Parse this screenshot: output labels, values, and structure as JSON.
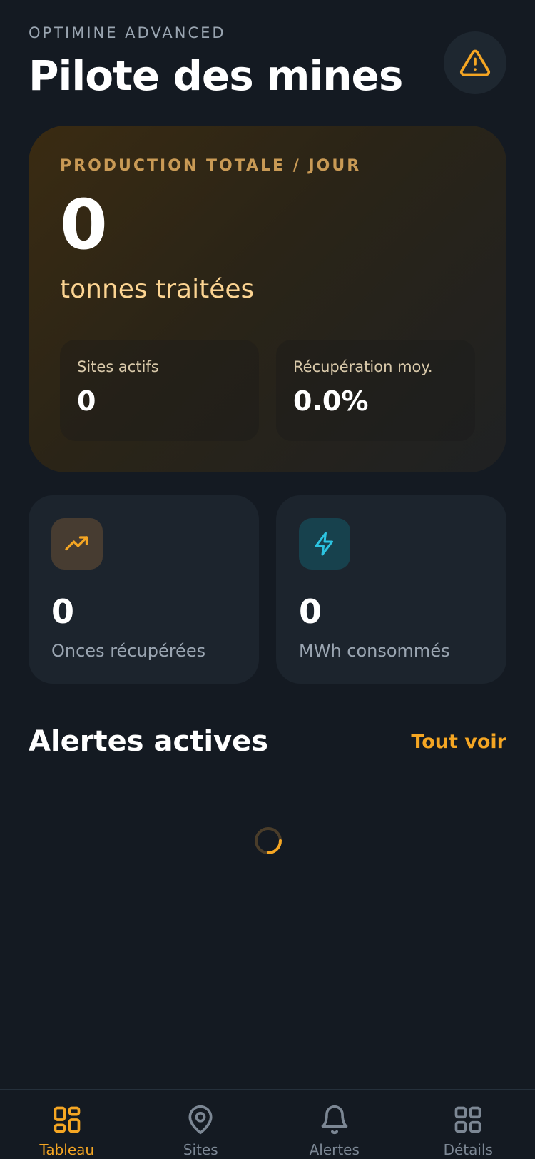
{
  "header": {
    "eyebrow": "OPTIMINE ADVANCED",
    "title": "Pilote des mines",
    "alert_icon": "warning-triangle-icon"
  },
  "hero": {
    "label": "PRODUCTION TOTALE / JOUR",
    "value": "0",
    "unit": "tonnes traitées",
    "stats": [
      {
        "label": "Sites actifs",
        "value": "0"
      },
      {
        "label": "Récupération moy.",
        "value": "0.0%"
      }
    ]
  },
  "cards": [
    {
      "icon": "trending-up-icon",
      "value": "0",
      "label": "Onces récupérées",
      "accent": "#f5a623"
    },
    {
      "icon": "lightning-icon",
      "value": "0",
      "label": "MWh consommés",
      "accent": "#2cc3e0"
    }
  ],
  "alerts_section": {
    "title": "Alertes actives",
    "link": "Tout voir"
  },
  "tabbar": {
    "items": [
      {
        "label": "Tableau",
        "icon": "dashboard-icon",
        "active": true
      },
      {
        "label": "Sites",
        "icon": "map-pin-icon",
        "active": false
      },
      {
        "label": "Alertes",
        "icon": "bell-icon",
        "active": false
      },
      {
        "label": "Détails",
        "icon": "grid-icon",
        "active": false
      }
    ]
  },
  "colors": {
    "accent": "#f5a623",
    "background": "#141a22",
    "card": "#1c242d",
    "cyan": "#2cc3e0"
  }
}
